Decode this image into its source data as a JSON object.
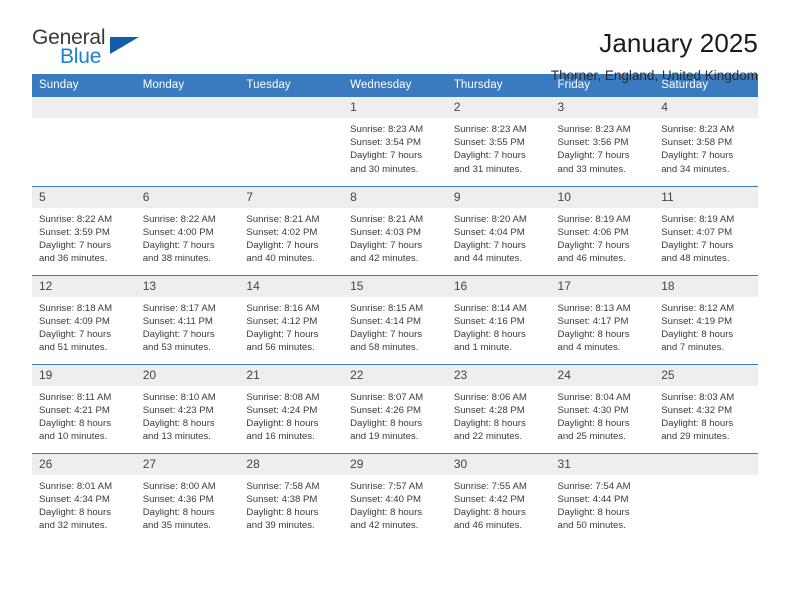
{
  "brand": {
    "name_part1": "General",
    "name_part2": "Blue",
    "accent_color": "#1d7fd4",
    "triangle_color": "#105ea8"
  },
  "header": {
    "title": "January 2025",
    "subtitle": "Thorner, England, United Kingdom"
  },
  "theme": {
    "header_row_bg": "#3a7bbf",
    "daynum_bg": "#eeeeee",
    "text_color": "#3b3b3b"
  },
  "weekday_headers": [
    "Sunday",
    "Monday",
    "Tuesday",
    "Wednesday",
    "Thursday",
    "Friday",
    "Saturday"
  ],
  "labels": {
    "sunrise_prefix": "Sunrise:",
    "sunset_prefix": "Sunset:",
    "daylight_prefix": "Daylight:"
  },
  "weeks": [
    [
      {
        "day": "",
        "blank": true
      },
      {
        "day": "",
        "blank": true
      },
      {
        "day": "",
        "blank": true
      },
      {
        "day": "1",
        "sunrise": "Sunrise: 8:23 AM",
        "sunset": "Sunset: 3:54 PM",
        "daylight_line1": "Daylight: 7 hours",
        "daylight_line2": "and 30 minutes."
      },
      {
        "day": "2",
        "sunrise": "Sunrise: 8:23 AM",
        "sunset": "Sunset: 3:55 PM",
        "daylight_line1": "Daylight: 7 hours",
        "daylight_line2": "and 31 minutes."
      },
      {
        "day": "3",
        "sunrise": "Sunrise: 8:23 AM",
        "sunset": "Sunset: 3:56 PM",
        "daylight_line1": "Daylight: 7 hours",
        "daylight_line2": "and 33 minutes."
      },
      {
        "day": "4",
        "sunrise": "Sunrise: 8:23 AM",
        "sunset": "Sunset: 3:58 PM",
        "daylight_line1": "Daylight: 7 hours",
        "daylight_line2": "and 34 minutes."
      }
    ],
    [
      {
        "day": "5",
        "sunrise": "Sunrise: 8:22 AM",
        "sunset": "Sunset: 3:59 PM",
        "daylight_line1": "Daylight: 7 hours",
        "daylight_line2": "and 36 minutes."
      },
      {
        "day": "6",
        "sunrise": "Sunrise: 8:22 AM",
        "sunset": "Sunset: 4:00 PM",
        "daylight_line1": "Daylight: 7 hours",
        "daylight_line2": "and 38 minutes."
      },
      {
        "day": "7",
        "sunrise": "Sunrise: 8:21 AM",
        "sunset": "Sunset: 4:02 PM",
        "daylight_line1": "Daylight: 7 hours",
        "daylight_line2": "and 40 minutes."
      },
      {
        "day": "8",
        "sunrise": "Sunrise: 8:21 AM",
        "sunset": "Sunset: 4:03 PM",
        "daylight_line1": "Daylight: 7 hours",
        "daylight_line2": "and 42 minutes."
      },
      {
        "day": "9",
        "sunrise": "Sunrise: 8:20 AM",
        "sunset": "Sunset: 4:04 PM",
        "daylight_line1": "Daylight: 7 hours",
        "daylight_line2": "and 44 minutes."
      },
      {
        "day": "10",
        "sunrise": "Sunrise: 8:19 AM",
        "sunset": "Sunset: 4:06 PM",
        "daylight_line1": "Daylight: 7 hours",
        "daylight_line2": "and 46 minutes."
      },
      {
        "day": "11",
        "sunrise": "Sunrise: 8:19 AM",
        "sunset": "Sunset: 4:07 PM",
        "daylight_line1": "Daylight: 7 hours",
        "daylight_line2": "and 48 minutes."
      }
    ],
    [
      {
        "day": "12",
        "sunrise": "Sunrise: 8:18 AM",
        "sunset": "Sunset: 4:09 PM",
        "daylight_line1": "Daylight: 7 hours",
        "daylight_line2": "and 51 minutes."
      },
      {
        "day": "13",
        "sunrise": "Sunrise: 8:17 AM",
        "sunset": "Sunset: 4:11 PM",
        "daylight_line1": "Daylight: 7 hours",
        "daylight_line2": "and 53 minutes."
      },
      {
        "day": "14",
        "sunrise": "Sunrise: 8:16 AM",
        "sunset": "Sunset: 4:12 PM",
        "daylight_line1": "Daylight: 7 hours",
        "daylight_line2": "and 56 minutes."
      },
      {
        "day": "15",
        "sunrise": "Sunrise: 8:15 AM",
        "sunset": "Sunset: 4:14 PM",
        "daylight_line1": "Daylight: 7 hours",
        "daylight_line2": "and 58 minutes."
      },
      {
        "day": "16",
        "sunrise": "Sunrise: 8:14 AM",
        "sunset": "Sunset: 4:16 PM",
        "daylight_line1": "Daylight: 8 hours",
        "daylight_line2": "and 1 minute."
      },
      {
        "day": "17",
        "sunrise": "Sunrise: 8:13 AM",
        "sunset": "Sunset: 4:17 PM",
        "daylight_line1": "Daylight: 8 hours",
        "daylight_line2": "and 4 minutes."
      },
      {
        "day": "18",
        "sunrise": "Sunrise: 8:12 AM",
        "sunset": "Sunset: 4:19 PM",
        "daylight_line1": "Daylight: 8 hours",
        "daylight_line2": "and 7 minutes."
      }
    ],
    [
      {
        "day": "19",
        "sunrise": "Sunrise: 8:11 AM",
        "sunset": "Sunset: 4:21 PM",
        "daylight_line1": "Daylight: 8 hours",
        "daylight_line2": "and 10 minutes."
      },
      {
        "day": "20",
        "sunrise": "Sunrise: 8:10 AM",
        "sunset": "Sunset: 4:23 PM",
        "daylight_line1": "Daylight: 8 hours",
        "daylight_line2": "and 13 minutes."
      },
      {
        "day": "21",
        "sunrise": "Sunrise: 8:08 AM",
        "sunset": "Sunset: 4:24 PM",
        "daylight_line1": "Daylight: 8 hours",
        "daylight_line2": "and 16 minutes."
      },
      {
        "day": "22",
        "sunrise": "Sunrise: 8:07 AM",
        "sunset": "Sunset: 4:26 PM",
        "daylight_line1": "Daylight: 8 hours",
        "daylight_line2": "and 19 minutes."
      },
      {
        "day": "23",
        "sunrise": "Sunrise: 8:06 AM",
        "sunset": "Sunset: 4:28 PM",
        "daylight_line1": "Daylight: 8 hours",
        "daylight_line2": "and 22 minutes."
      },
      {
        "day": "24",
        "sunrise": "Sunrise: 8:04 AM",
        "sunset": "Sunset: 4:30 PM",
        "daylight_line1": "Daylight: 8 hours",
        "daylight_line2": "and 25 minutes."
      },
      {
        "day": "25",
        "sunrise": "Sunrise: 8:03 AM",
        "sunset": "Sunset: 4:32 PM",
        "daylight_line1": "Daylight: 8 hours",
        "daylight_line2": "and 29 minutes."
      }
    ],
    [
      {
        "day": "26",
        "sunrise": "Sunrise: 8:01 AM",
        "sunset": "Sunset: 4:34 PM",
        "daylight_line1": "Daylight: 8 hours",
        "daylight_line2": "and 32 minutes."
      },
      {
        "day": "27",
        "sunrise": "Sunrise: 8:00 AM",
        "sunset": "Sunset: 4:36 PM",
        "daylight_line1": "Daylight: 8 hours",
        "daylight_line2": "and 35 minutes."
      },
      {
        "day": "28",
        "sunrise": "Sunrise: 7:58 AM",
        "sunset": "Sunset: 4:38 PM",
        "daylight_line1": "Daylight: 8 hours",
        "daylight_line2": "and 39 minutes."
      },
      {
        "day": "29",
        "sunrise": "Sunrise: 7:57 AM",
        "sunset": "Sunset: 4:40 PM",
        "daylight_line1": "Daylight: 8 hours",
        "daylight_line2": "and 42 minutes."
      },
      {
        "day": "30",
        "sunrise": "Sunrise: 7:55 AM",
        "sunset": "Sunset: 4:42 PM",
        "daylight_line1": "Daylight: 8 hours",
        "daylight_line2": "and 46 minutes."
      },
      {
        "day": "31",
        "sunrise": "Sunrise: 7:54 AM",
        "sunset": "Sunset: 4:44 PM",
        "daylight_line1": "Daylight: 8 hours",
        "daylight_line2": "and 50 minutes."
      },
      {
        "day": "",
        "blank": true
      }
    ]
  ]
}
